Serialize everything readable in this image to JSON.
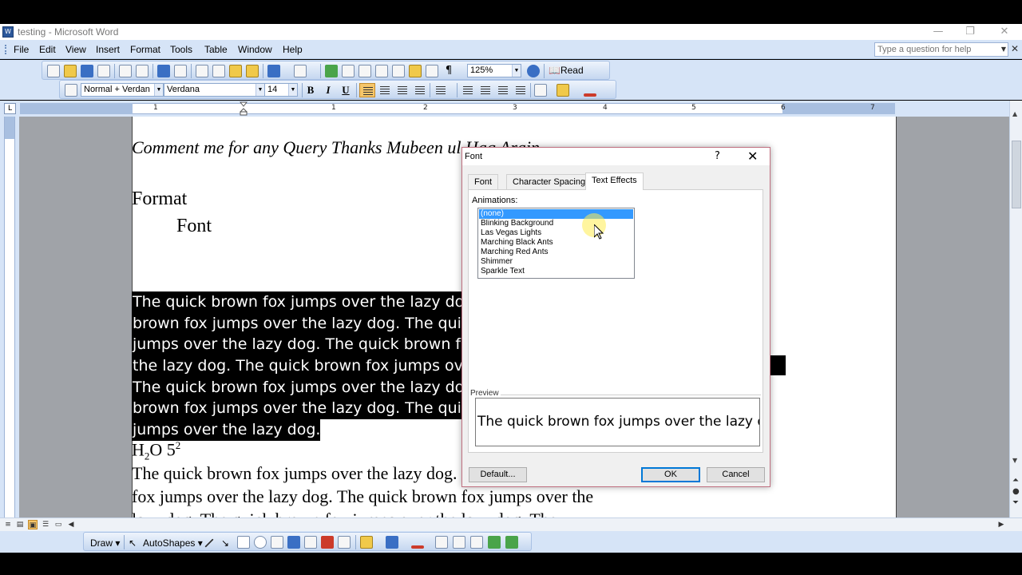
{
  "window": {
    "title": "testing - Microsoft Word",
    "minimize": "—",
    "restore": "❐",
    "close": "✕"
  },
  "menu": {
    "items": [
      "File",
      "Edit",
      "View",
      "Insert",
      "Format",
      "Tools",
      "Table",
      "Window",
      "Help"
    ],
    "question_placeholder": "Type a question for help",
    "close_doc": "✕"
  },
  "toolbar": {
    "zoom": "125%",
    "read_label": "Read",
    "style": "Normal + Verdan",
    "font": "Verdana",
    "size": "14",
    "bold": "B",
    "italic": "I",
    "underline": "U"
  },
  "ruler": {
    "corner": "L",
    "numbers": [
      "1",
      "1",
      "2",
      "3",
      "4",
      "5",
      "6",
      "7"
    ]
  },
  "document": {
    "comment_line": "Comment me for any Query Thanks Mubeen ul Haq Arain",
    "heading_format": "Format",
    "heading_font": "Font",
    "highlighted_lines": [
      "The quick brown fox jumps over the lazy dog.  The quick",
      "brown fox jumps over the lazy dog.  The quick brown fox",
      "jumps over the lazy dog.  The quick brown fox jumps over",
      "the lazy dog.  The quick brown fox jumps over the lazy dog.",
      "The quick brown fox jumps over the lazy dog.  The quick",
      "brown fox jumps over the lazy dog.  The quick brown fox",
      "jumps over the lazy dog."
    ],
    "formula_h": "H",
    "formula_sub": "2",
    "formula_o": "O 5",
    "formula_sup": "2",
    "para_lines": [
      "The quick brown fox jumps over the lazy dog.  The quick brown",
      "fox jumps over the lazy dog.  The quick brown fox jumps over the",
      "lazy dog.  The quick brown fox jumps over the lazy dog.  The"
    ]
  },
  "drawbar": {
    "draw": "Draw",
    "autoshapes": "AutoShapes"
  },
  "dialog": {
    "title": "Font",
    "help": "?",
    "close": "✕",
    "tabs": [
      "Font",
      "Character Spacing",
      "Text Effects"
    ],
    "active_tab": "Text Effects",
    "animations_label": "Animations:",
    "animations": [
      "(none)",
      "Blinking Background",
      "Las Vegas Lights",
      "Marching Black Ants",
      "Marching Red Ants",
      "Shimmer",
      "Sparkle Text"
    ],
    "selected_animation": "(none)",
    "preview_label": "Preview",
    "preview_text": "The quick brown fox jumps over the lazy dog",
    "default_button": "Default...",
    "ok_button": "OK",
    "cancel_button": "Cancel"
  },
  "colors": {
    "accent": "#0078d7",
    "toolbar_bg": "#d6e4f7",
    "selection": "#3399ff"
  }
}
